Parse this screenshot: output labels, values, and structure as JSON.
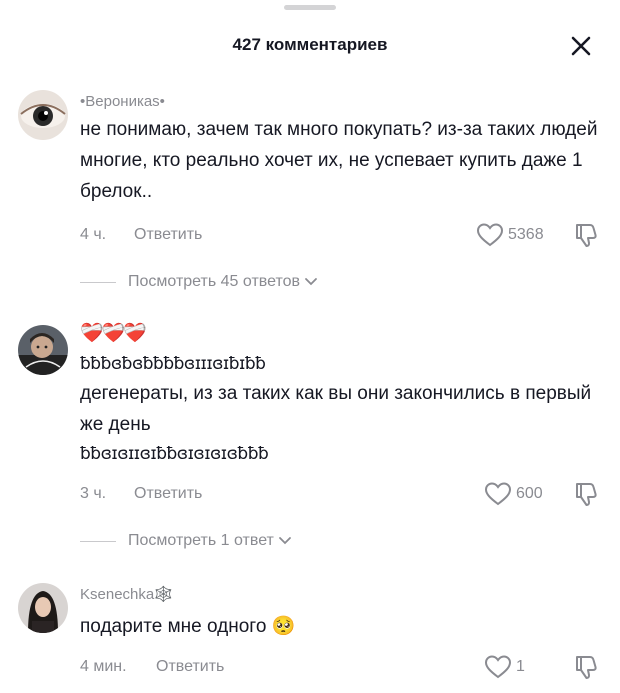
{
  "header": {
    "title": "427 комментариев"
  },
  "comments": [
    {
      "username": "•Вероникаѕ•",
      "text": "не понимаю, зачем так много покупать? из-за таких людей многие, кто реально хочет их, не успевает купить даже 1 брелок..",
      "time": "4 ч.",
      "reply_label": "Ответить",
      "likes": "5368",
      "view_replies": "Посмотреть 45 ответов"
    },
    {
      "username": "❤️‍🩹❤️‍🩹❤️‍🩹",
      "deco_line_1": "ƀƀƀɞƀɞƀƀƀƀɞɪɪɪɞɪƀɪƀƀ",
      "text": "дегенераты, из за таких как вы они закончились в первый же день",
      "deco_line_2": "ƀƀɞɪɞɪɪɞɪƀƀɞɪɞɪɞɪɞƀƀƀ",
      "time": "3 ч.",
      "reply_label": "Ответить",
      "likes": "600",
      "view_replies": "Посмотреть 1 ответ"
    },
    {
      "username": "Ksenechka🕸️",
      "text": "подарите мне одного 🥺",
      "time": "4 мин.",
      "reply_label": "Ответить",
      "likes": "1"
    }
  ],
  "icons": {
    "close": "close-icon",
    "like": "heart-outline-icon",
    "dislike": "thumbs-down-icon",
    "chevron": "chevron-down-icon"
  }
}
